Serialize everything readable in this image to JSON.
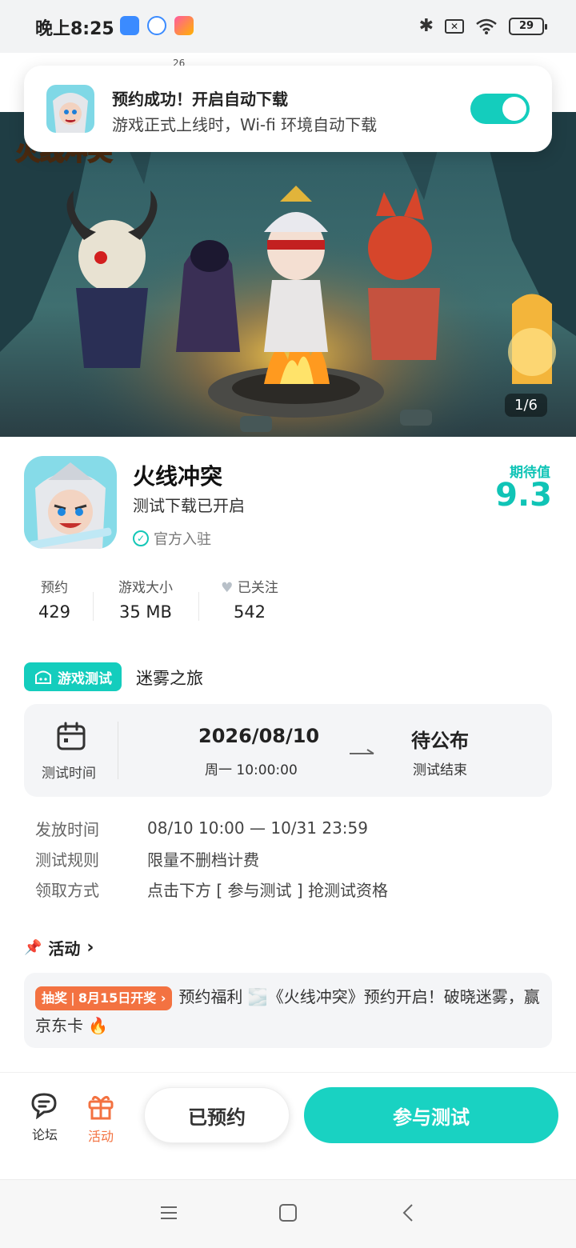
{
  "status_bar": {
    "time": "晚上8:25",
    "battery": "29",
    "date_hint": "26"
  },
  "notification": {
    "title": "预约成功！开启自动下载",
    "subtitle": "游戏正式上线时，Wi-fi 环境自动下载",
    "toggle_on": true
  },
  "hero": {
    "counter": "1/6",
    "logo_text": "火线冲突"
  },
  "game": {
    "title": "火线冲突",
    "subtitle": "测试下载已开启",
    "official": "官方入驻",
    "rating_label": "期待值",
    "rating_value": "9.3"
  },
  "stats": [
    {
      "label": "预约",
      "value": "429"
    },
    {
      "label": "游戏大小",
      "value": "35 MB"
    },
    {
      "label": "已关注",
      "value": "542"
    }
  ],
  "test": {
    "tag": "游戏测试",
    "name": "迷雾之旅",
    "time_label": "测试时间",
    "start_date": "2026/08/10",
    "start_time": "周一  10:00:00",
    "end_date": "待公布",
    "end_label": "测试结束",
    "rows": [
      {
        "key": "发放时间",
        "value": "08/10 10:00 — 10/31 23:59"
      },
      {
        "key": "测试规则",
        "value": "限量不删档计费"
      },
      {
        "key": "领取方式",
        "value": "点击下方 [ 参与测试 ] 抢测试资格"
      }
    ]
  },
  "activity": {
    "heading": "活动",
    "badge_main": "抽奖",
    "badge_date": "8月15日开奖",
    "text": "预约福利 🌫️《火线冲突》预约开启！破晓迷雾，赢京东卡 🔥"
  },
  "bottom": {
    "forum": "论坛",
    "activity": "活动",
    "reserved": "已预约",
    "join": "参与测试"
  },
  "colors": {
    "accent": "#14cdbd",
    "orange": "#f37241"
  }
}
